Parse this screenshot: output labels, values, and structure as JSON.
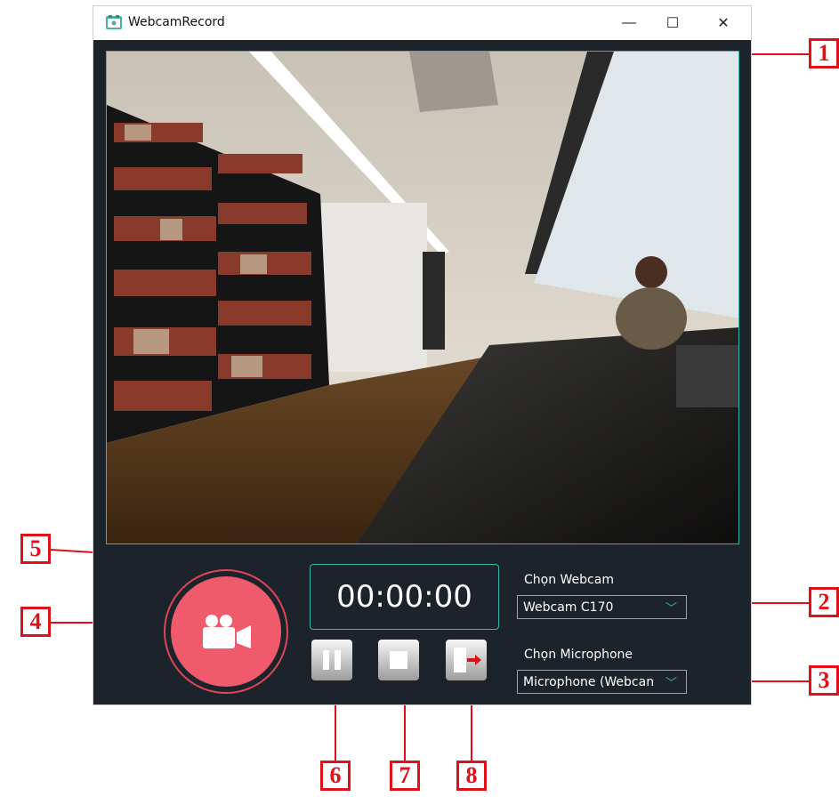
{
  "window": {
    "title": "WebcamRecord",
    "minimize_glyph": "—",
    "maximize_glyph": "☐",
    "close_glyph": "✕"
  },
  "timer": {
    "value": "00:00:00"
  },
  "webcam": {
    "label": "Chọn Webcam",
    "selected": "Webcam C170"
  },
  "microphone": {
    "label": "Chọn Microphone",
    "selected": "Microphone (Webcan"
  },
  "icons": {
    "record": "video-camera-icon",
    "pause": "pause-icon",
    "stop": "stop-icon",
    "exit": "exit-door-icon",
    "dropdown": "chevron-down-icon"
  },
  "colors": {
    "accent": "#2fb8a8",
    "record_button": "#ef5a6d",
    "callout": "#e0101a",
    "window_bg": "#1d232b"
  },
  "callouts": [
    "1",
    "2",
    "3",
    "4",
    "5",
    "6",
    "7",
    "8"
  ]
}
